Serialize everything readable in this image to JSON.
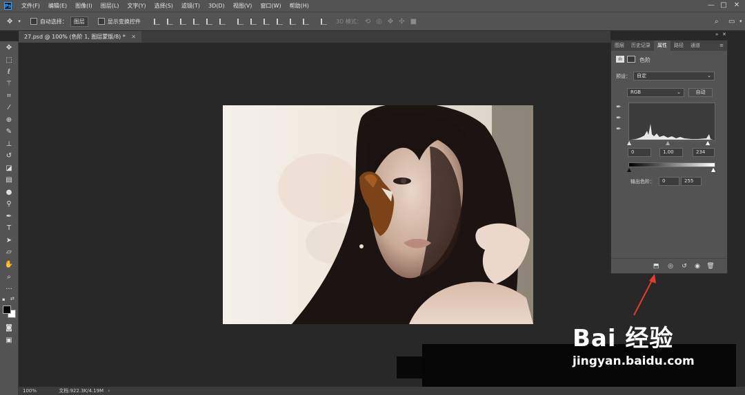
{
  "menubar": {
    "logo": "Ps",
    "items": [
      "文件(F)",
      "编辑(E)",
      "图像(I)",
      "图层(L)",
      "文字(Y)",
      "选择(S)",
      "滤镜(T)",
      "3D(D)",
      "视图(V)",
      "窗口(W)",
      "帮助(H)"
    ],
    "window_controls": [
      "—",
      "□",
      "✕"
    ]
  },
  "options": {
    "auto_select_label": "自动选择：",
    "auto_select_value": "图层",
    "transform_label": "显示变换控件",
    "mode_3d_label": "3D 模式："
  },
  "document_tab": {
    "label": "27.psd @ 100% (色阶 1, 图层蒙版/8) *"
  },
  "status": {
    "zoom": "100%",
    "doc_info": "文档:922.3K/4.19M"
  },
  "panel": {
    "tabs": [
      "图层",
      "历史记录",
      "属性",
      "路径",
      "通道"
    ],
    "active_tab": "属性",
    "title": "色阶",
    "preset_label": "预设：",
    "preset_value": "自定",
    "channel_value": "RGB",
    "auto_label": "自动",
    "input_black": "0",
    "input_gamma": "1.00",
    "input_white": "234",
    "output_label": "输出色阶：",
    "output_black": "0",
    "output_white": "255"
  },
  "watermark": {
    "brand": "Bai 经验",
    "url": "jingyan.baidu.com"
  },
  "colors": {
    "ui_gray": "#535353",
    "canvas_bg": "#282828",
    "accent_arrow": "#e53b2c"
  }
}
